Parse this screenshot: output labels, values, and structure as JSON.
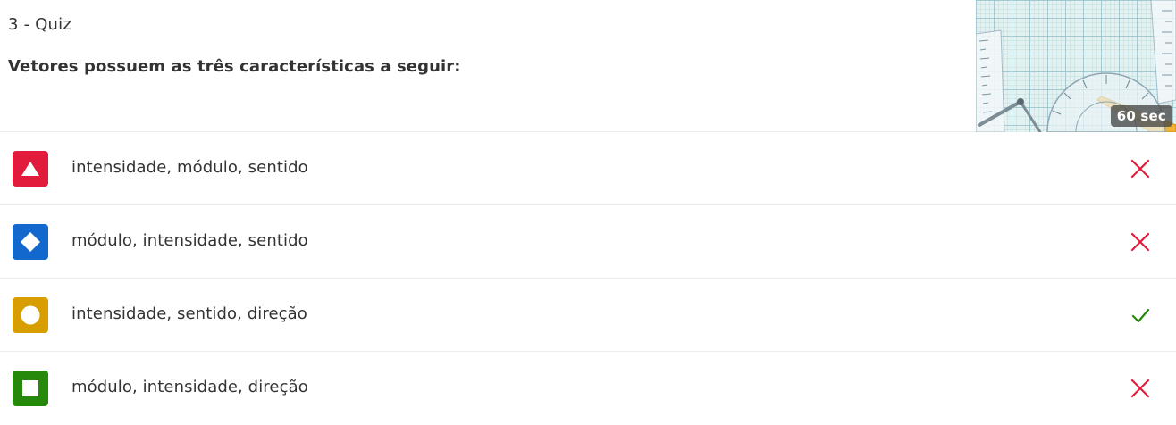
{
  "question": {
    "number_label": "3 - Quiz",
    "text": "Vetores possuem as três características a seguir:",
    "timer_label": "60 sec",
    "image_icon": "geometry-tools-image"
  },
  "answers": [
    {
      "label": "intensidade, módulo, sentido",
      "shape_icon": "triangle-icon",
      "color": "#e21b3c",
      "result": "incorrect",
      "result_icon": "x-icon"
    },
    {
      "label": "módulo, intensidade, sentido",
      "shape_icon": "diamond-icon",
      "color": "#1368ce",
      "result": "incorrect",
      "result_icon": "x-icon"
    },
    {
      "label": "intensidade, sentido, direção",
      "shape_icon": "circle-icon",
      "color": "#d89e00",
      "result": "correct",
      "result_icon": "check-icon"
    },
    {
      "label": "módulo, intensidade, direção",
      "shape_icon": "square-icon",
      "color": "#26890c",
      "result": "incorrect",
      "result_icon": "x-icon"
    }
  ],
  "colors": {
    "incorrect": "#e21b3c",
    "correct": "#26890c",
    "text": "#333333",
    "divider": "#ebebeb"
  }
}
